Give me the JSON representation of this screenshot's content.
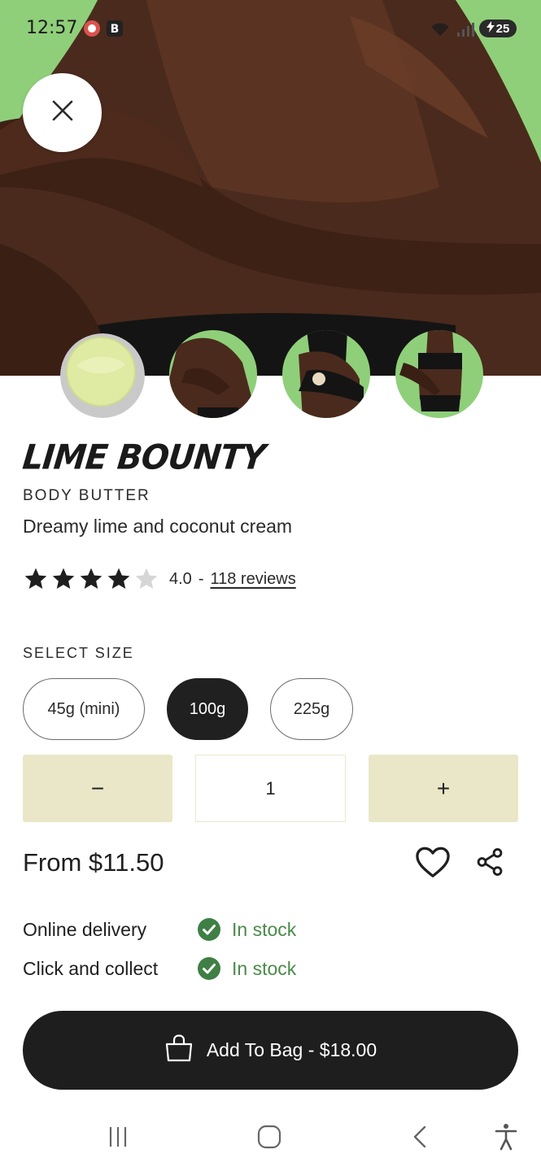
{
  "status_bar": {
    "time": "12:57",
    "battery": "25"
  },
  "product": {
    "title": "LIME BOUNTY",
    "category": "BODY BUTTER",
    "description": "Dreamy lime and coconut cream",
    "rating": 4.0,
    "rating_text": "4.0",
    "rating_separator": "-",
    "reviews_link": "118 reviews",
    "price": "From $11.50"
  },
  "size": {
    "label": "SELECT SIZE",
    "options": [
      "45g (mini)",
      "100g",
      "225g"
    ],
    "selected": "100g"
  },
  "quantity": {
    "decrement_label": "−",
    "value": "1",
    "increment_label": "+"
  },
  "availability": [
    {
      "label": "Online delivery",
      "status": "In stock"
    },
    {
      "label": "Click and collect",
      "status": "In stock"
    }
  ],
  "cta": {
    "add_to_bag": "Add To Bag - $18.00"
  },
  "colors": {
    "accent_dark": "#1e1e1e",
    "qty_bg": "#e9e7c7",
    "in_stock_green": "#4a8a4a",
    "hero_bg": "#8fcf7a"
  },
  "icons": {
    "close": "close-icon",
    "wishlist": "heart-icon",
    "share": "share-icon",
    "bag": "shopping-bag-icon",
    "check": "check-circle-icon"
  }
}
